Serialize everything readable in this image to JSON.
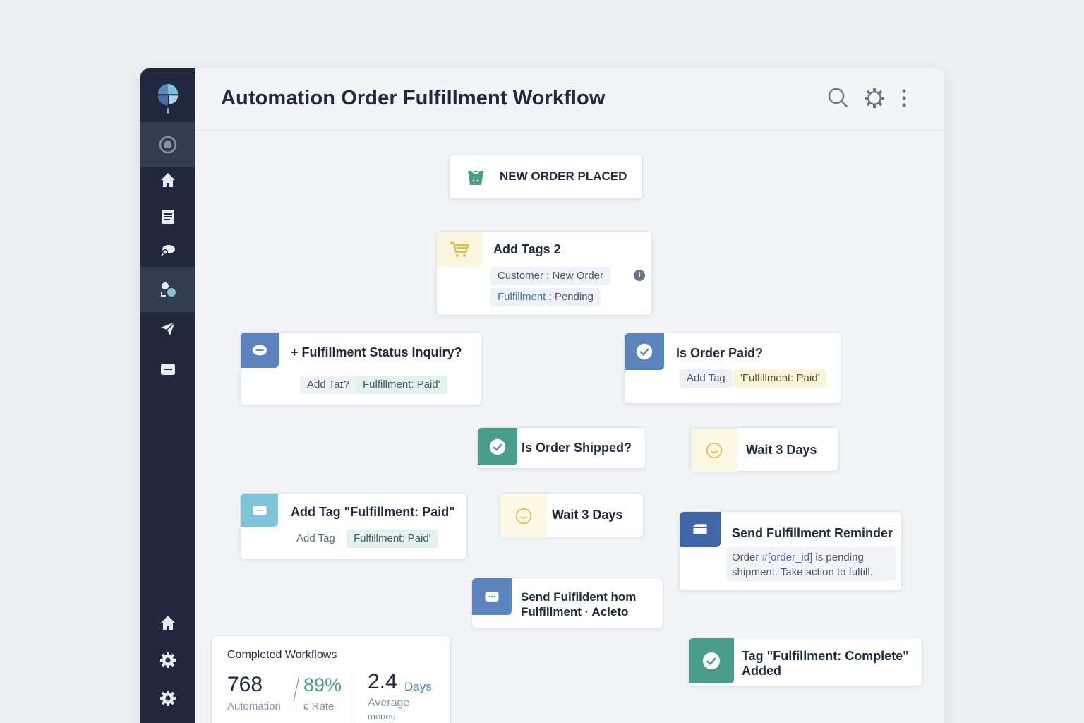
{
  "header": {
    "title": "Automation Order Fulfillment Workflow"
  },
  "sidebar": {
    "items": [
      {
        "icon": "inbox-icon"
      },
      {
        "icon": "home-icon"
      },
      {
        "icon": "document-icon"
      },
      {
        "icon": "chat-icon"
      },
      {
        "icon": "workflow-icon"
      },
      {
        "icon": "send-icon"
      },
      {
        "icon": "message-icon"
      },
      {
        "icon": "home-icon"
      },
      {
        "icon": "gear-icon"
      },
      {
        "icon": "gear-icon"
      }
    ]
  },
  "colors": {
    "sidebar": "#1f283d",
    "teal": "#4a9d8a",
    "blue": "#5b83be",
    "light_blue": "#7ec3d8",
    "yellow": "#f6ecbe"
  },
  "nodes": {
    "trigger": {
      "title": "NEW ORDER PLACED"
    },
    "add_tags": {
      "title": "Add Tags 2",
      "chip1": "Customer : New Order",
      "chip2_key": "Fulfillment",
      "chip2_rest": " : Pending"
    },
    "status_inquiry": {
      "title": "+ Fulfillment Status Inquiry?",
      "tag_label": "Add Taɪ?",
      "tag_value": "Fulfillment: Paid'"
    },
    "order_paid": {
      "title": "Is Order Paid?",
      "tag_label": "Add Tag",
      "tag_value": "'Fulfillment: Paid'"
    },
    "order_shipped": {
      "title": "Is Order Shipped?"
    },
    "wait_right": {
      "title": "Wait 3 Days"
    },
    "add_tag_paid": {
      "title": "Add Tag \"Fulfillment: Paid\"",
      "tag_label": "Add Tag",
      "tag_value": "Fulfillment: Paid'"
    },
    "wait_center": {
      "title": "Wait 3 Days"
    },
    "reminder": {
      "title": "Send Fulfillment Reminder",
      "body_pre": "Order ",
      "body_var": "#[order_id]",
      "body_post": " is pending",
      "body_line2": "shipment. Take action to fulfill."
    },
    "send_fulfillment": {
      "line1": "Send Fulfiident hom",
      "line2": "Fulfillment · Acleto"
    },
    "tag_complete": {
      "line1": "Tag \"Fulfillment: Complete\"",
      "line2": "Added"
    }
  },
  "stats": {
    "title": "Completed Workflows",
    "automation_value": "768",
    "automation_label": "Automation",
    "rate_value": "89%",
    "rate_label": "ɕ Rate",
    "days_value": "2.4",
    "days_unit": "Days",
    "days_label": "Average",
    "days_label2": "moɒes"
  }
}
